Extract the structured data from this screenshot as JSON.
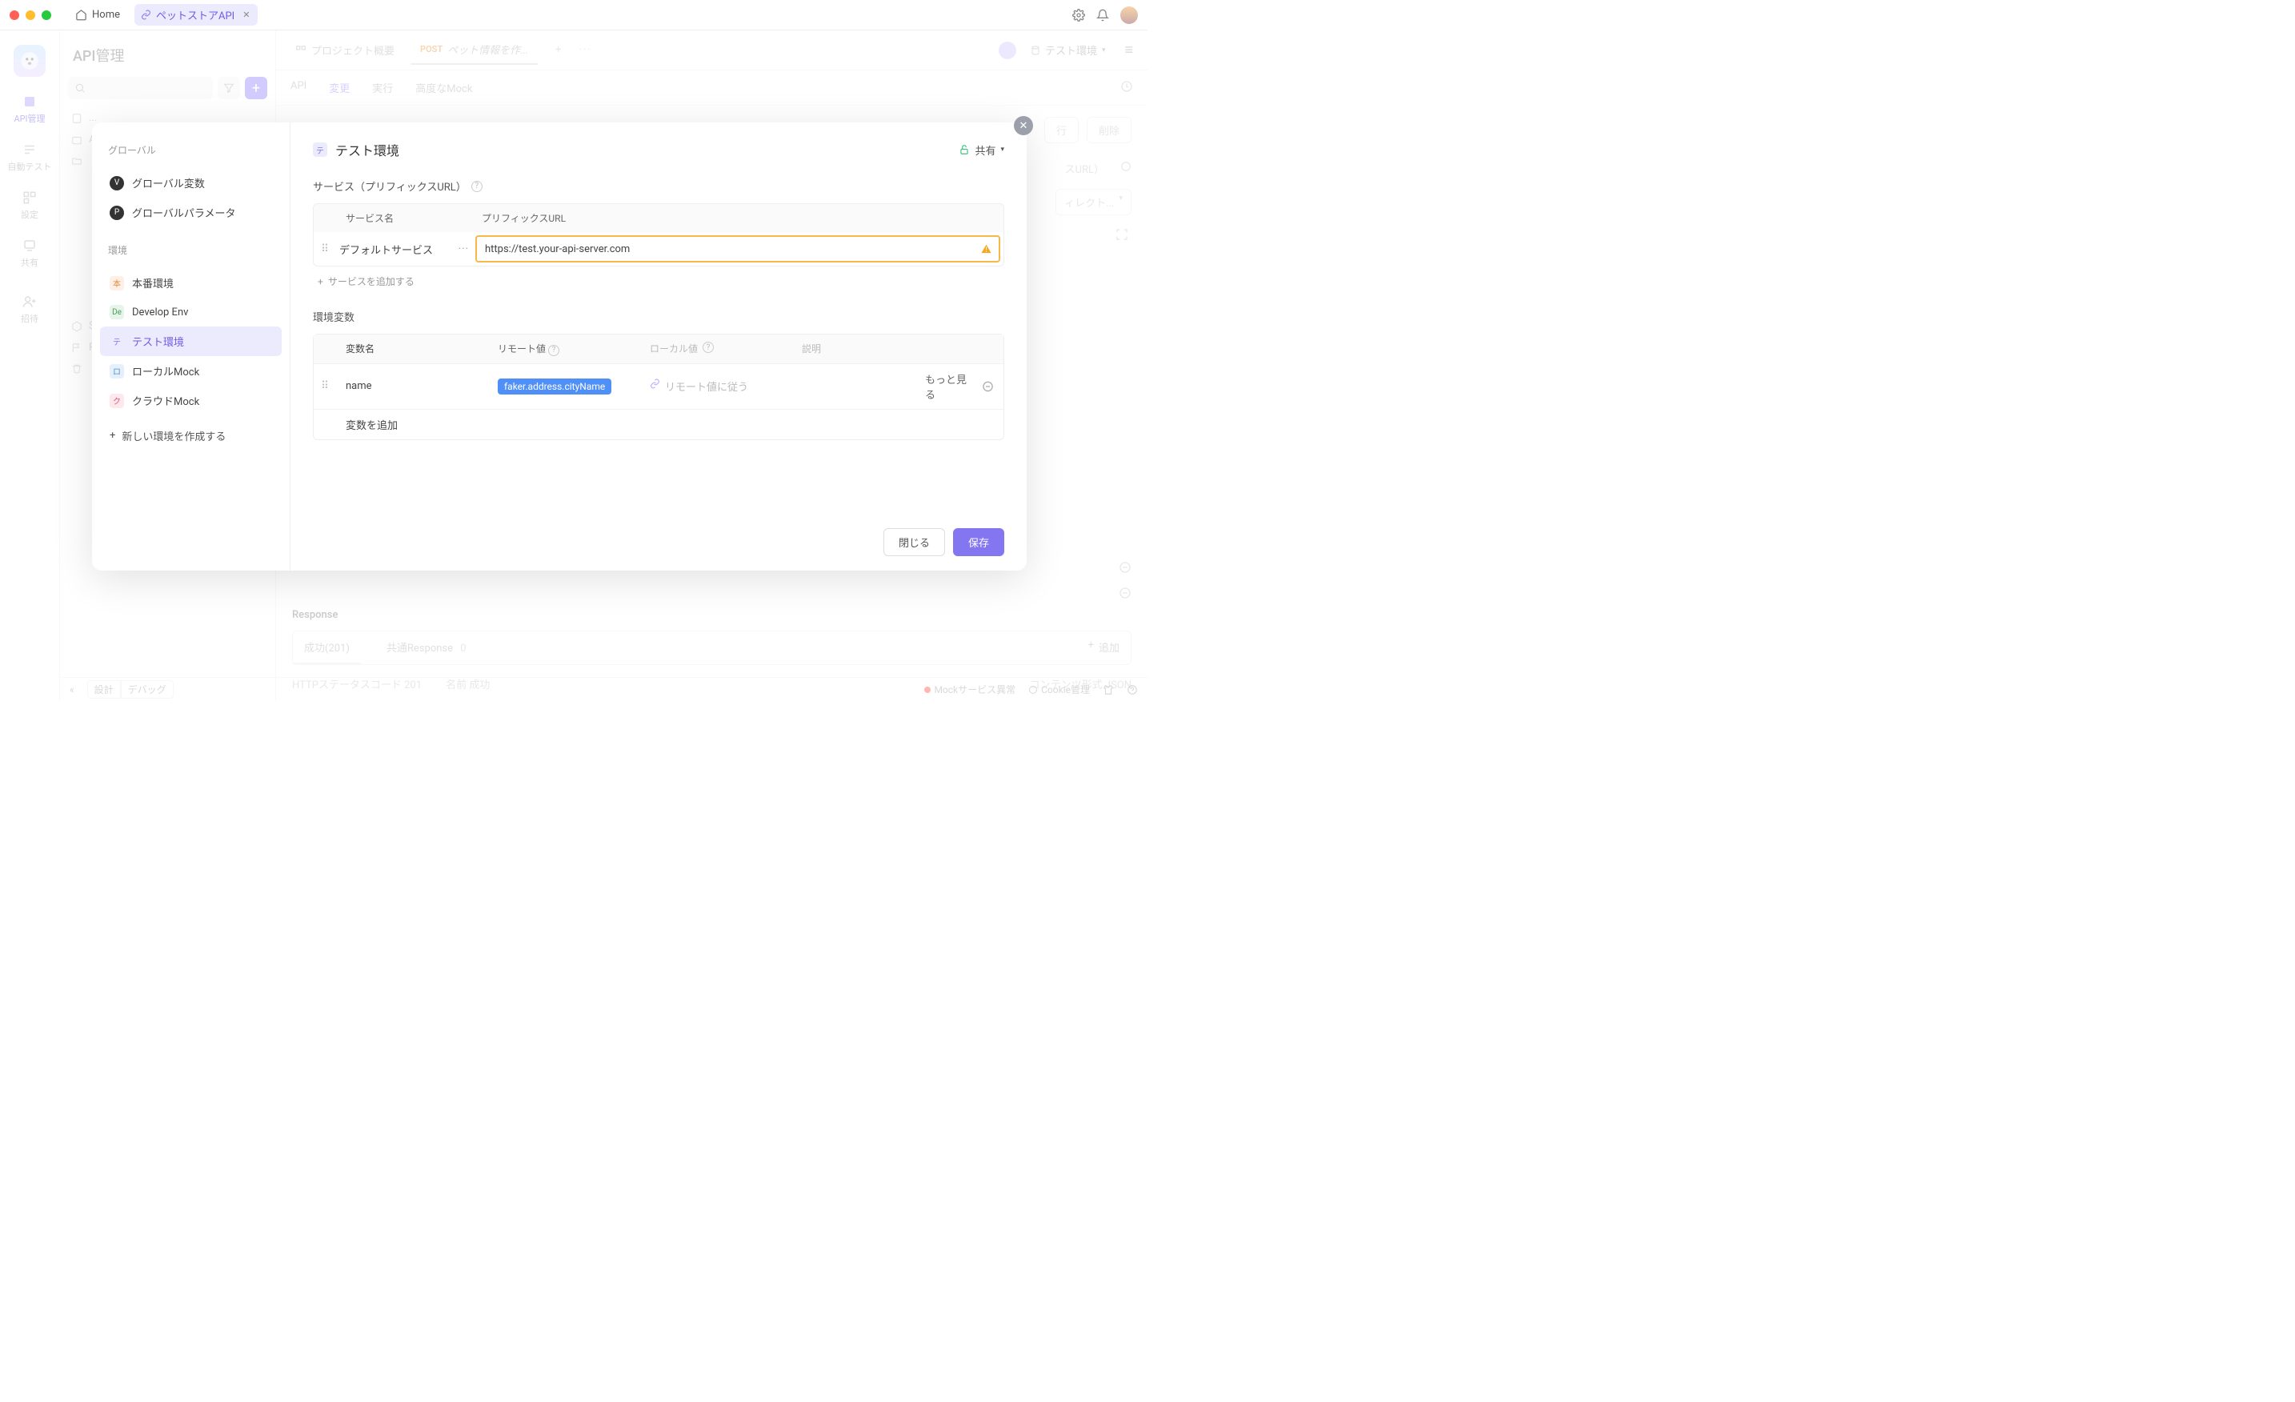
{
  "window": {
    "home": "Home",
    "project_tab": "ペットストアAPI"
  },
  "rail": {
    "api": "API管理",
    "test": "自動テスト",
    "settings": "設定",
    "share": "共有",
    "invite": "招待"
  },
  "left_panel": {
    "title": "API管理"
  },
  "main_header": {
    "overview": "プロジェクト概要",
    "tab_method": "POST",
    "tab_title": "ペット情報を作...",
    "env": "テスト環境"
  },
  "background": {
    "run": "行",
    "delete": "削除",
    "url_label": "スURL）",
    "dir": "ィレクト..."
  },
  "subtabs": {
    "api": "API",
    "change": "変更",
    "run": "実行",
    "mock": "高度なMock"
  },
  "response": {
    "label": "Response",
    "success": "成功(201)",
    "common": "共通Response",
    "common_count": "0",
    "add": "追加",
    "http": "HTTPステータスコード",
    "http_val": "201",
    "name": "名前",
    "name_val": "成功",
    "ctype": "コンテンツ形式",
    "ctype_val": "JSON"
  },
  "bottombar": {
    "design": "設計",
    "debug": "デバッグ",
    "mock_err": "Mockサービス異常",
    "cookie": "Cookie管理"
  },
  "modal": {
    "left": {
      "global": "グローバル",
      "gvars": "グローバル変数",
      "gparams": "グローバルパラメータ",
      "env_header": "環境",
      "envs": [
        {
          "badge": "本",
          "cls": "hon",
          "label": "本番環境"
        },
        {
          "badge": "De",
          "cls": "dev",
          "label": "Develop Env"
        },
        {
          "badge": "テ",
          "cls": "test",
          "label": "テスト環境",
          "selected": true
        },
        {
          "badge": "ロ",
          "cls": "local",
          "label": "ローカルMock"
        },
        {
          "badge": "ク",
          "cls": "cloud",
          "label": "クラウドMock"
        }
      ],
      "add_env": "新しい環境を作成する"
    },
    "right": {
      "title_badge": "テ",
      "title": "テスト環境",
      "share": "共有",
      "service_label": "サービス（プリフィックスURL）",
      "svc_head_name": "サービス名",
      "svc_head_url": "プリフィックスURL",
      "svc_name": "デフォルトサービス",
      "svc_url": "https://test.your-api-server.com",
      "add_service": "サービスを追加する",
      "envvar_label": "環境変数",
      "var_head_name": "変数名",
      "var_head_remote": "リモート値",
      "var_head_local": "ローカル値",
      "var_head_desc": "説明",
      "var_name": "name",
      "var_remote": "faker.address.cityName",
      "var_local": "リモート値に従う",
      "var_more": "もっと見る",
      "var_placeholder": "変数を追加",
      "footer_close": "閉じる",
      "footer_save": "保存"
    }
  }
}
